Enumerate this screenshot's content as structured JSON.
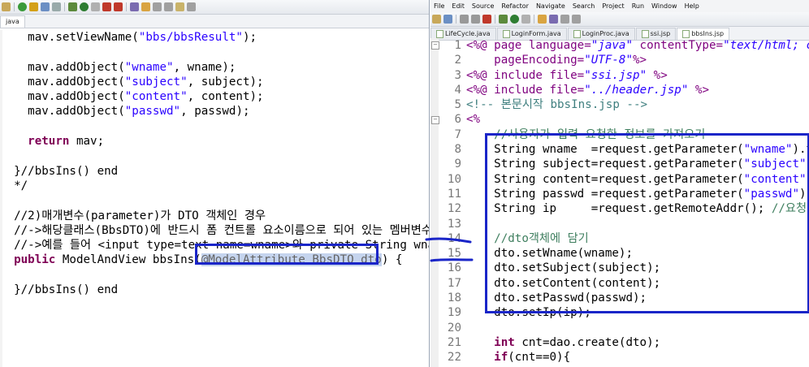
{
  "left_editor": {
    "tab_label": "java",
    "lines": [
      {
        "indent": "    ",
        "parts": [
          {
            "t": "mav.setViewName(",
            "c": ""
          },
          {
            "t": "\"bbs/bbsResult\"",
            "c": "str"
          },
          {
            "t": ");",
            "c": ""
          }
        ]
      },
      {
        "indent": "",
        "parts": []
      },
      {
        "indent": "    ",
        "parts": [
          {
            "t": "mav.addObject(",
            "c": ""
          },
          {
            "t": "\"wname\"",
            "c": "str"
          },
          {
            "t": ", wname);",
            "c": ""
          }
        ]
      },
      {
        "indent": "    ",
        "parts": [
          {
            "t": "mav.addObject(",
            "c": ""
          },
          {
            "t": "\"subject\"",
            "c": "str"
          },
          {
            "t": ", subject);",
            "c": ""
          }
        ]
      },
      {
        "indent": "    ",
        "parts": [
          {
            "t": "mav.addObject(",
            "c": ""
          },
          {
            "t": "\"content\"",
            "c": "str"
          },
          {
            "t": ", content);",
            "c": ""
          }
        ]
      },
      {
        "indent": "    ",
        "parts": [
          {
            "t": "mav.addObject(",
            "c": ""
          },
          {
            "t": "\"passwd\"",
            "c": "str"
          },
          {
            "t": ", passwd);",
            "c": ""
          }
        ]
      },
      {
        "indent": "",
        "parts": []
      },
      {
        "indent": "    ",
        "parts": [
          {
            "t": "return",
            "c": "kw"
          },
          {
            "t": " mav;",
            "c": ""
          }
        ]
      },
      {
        "indent": "",
        "parts": []
      },
      {
        "indent": "  ",
        "parts": [
          {
            "t": "}//bbsIns() end",
            "c": ""
          }
        ]
      },
      {
        "indent": "  ",
        "parts": [
          {
            "t": "*/",
            "c": ""
          }
        ]
      },
      {
        "indent": "",
        "parts": []
      },
      {
        "indent": "  ",
        "parts": [
          {
            "t": "//2)매개변수(parameter)가 DTO 객체인 경우",
            "c": ""
          }
        ]
      },
      {
        "indent": "  ",
        "parts": [
          {
            "t": "//->해당클래스(BbsDTO)에 반드시 폼 컨트롤 요소이름으로 되어 있는 멤버변수와",
            "c": ""
          }
        ]
      },
      {
        "indent": "  ",
        "parts": [
          {
            "t": "//->예를 들어 <input type=text name=wname>와 private String wnam",
            "c": ""
          }
        ]
      },
      {
        "indent": "  ",
        "parts": [
          {
            "t": "public",
            "c": "kw"
          },
          {
            "t": " ModelAndView bbsIns(",
            "c": ""
          },
          {
            "t": "@ModelAttribute BbsDTO dto",
            "c": "ann sel"
          },
          {
            "t": ") {",
            "c": ""
          }
        ]
      },
      {
        "indent": "",
        "parts": []
      },
      {
        "indent": "  ",
        "parts": [
          {
            "t": "}//bbsIns() end",
            "c": ""
          }
        ]
      }
    ]
  },
  "right_editor": {
    "menu": [
      "File",
      "Edit",
      "Source",
      "Refactor",
      "Navigate",
      "Search",
      "Project",
      "Run",
      "Window",
      "Help"
    ],
    "tabs": [
      "LifeCycle.java",
      "LoginForm.java",
      "LoginProc.java",
      "ssi.jsp",
      "bbsIns.jsp"
    ],
    "active_tab": 4,
    "line_numbers": [
      "1",
      "2",
      "3",
      "4",
      "5",
      "6",
      "7",
      "8",
      "9",
      "10",
      "11",
      "12",
      "13",
      "14",
      "15",
      "16",
      "17",
      "18",
      "19",
      "20",
      "21",
      "22"
    ],
    "lines": [
      {
        "indent": "",
        "parts": [
          {
            "t": "<%@ ",
            "c": "jsp"
          },
          {
            "t": "page ",
            "c": "jsp"
          },
          {
            "t": "language=",
            "c": "attr"
          },
          {
            "t": "\"java\"",
            "c": "aval"
          },
          {
            "t": " contentType=",
            "c": "attr"
          },
          {
            "t": "\"text/html; cha",
            "c": "aval"
          }
        ]
      },
      {
        "indent": "    ",
        "parts": [
          {
            "t": "pageEncoding=",
            "c": "attr"
          },
          {
            "t": "\"UTF-8\"",
            "c": "aval"
          },
          {
            "t": "%>",
            "c": "jsp"
          }
        ]
      },
      {
        "indent": "",
        "parts": [
          {
            "t": "<%@ ",
            "c": "jsp"
          },
          {
            "t": "include ",
            "c": "jsp"
          },
          {
            "t": "file=",
            "c": "attr"
          },
          {
            "t": "\"ssi.jsp\"",
            "c": "aval"
          },
          {
            "t": " %>",
            "c": "jsp"
          }
        ]
      },
      {
        "indent": "",
        "parts": [
          {
            "t": "<%@ ",
            "c": "jsp"
          },
          {
            "t": "include ",
            "c": "jsp"
          },
          {
            "t": "file=",
            "c": "attr"
          },
          {
            "t": "\"../header.jsp\"",
            "c": "aval"
          },
          {
            "t": " %>",
            "c": "jsp"
          }
        ]
      },
      {
        "indent": "",
        "parts": [
          {
            "t": "<!-- 본문시작 bbsIns.jsp -->",
            "c": "html"
          }
        ]
      },
      {
        "indent": "",
        "parts": [
          {
            "t": "<%",
            "c": "jsp"
          }
        ]
      },
      {
        "indent": "    ",
        "parts": [
          {
            "t": "//사용자가 입력 요청한 정보를 가져오기",
            "c": "cm"
          }
        ]
      },
      {
        "indent": "    ",
        "parts": [
          {
            "t": "String wname  =request.getParameter(",
            "c": ""
          },
          {
            "t": "\"wname\"",
            "c": "str"
          },
          {
            "t": ").tr",
            "c": ""
          }
        ]
      },
      {
        "indent": "    ",
        "parts": [
          {
            "t": "String subject=request.getParameter(",
            "c": ""
          },
          {
            "t": "\"subject\"",
            "c": "str"
          },
          {
            "t": ").",
            "c": ""
          }
        ]
      },
      {
        "indent": "    ",
        "parts": [
          {
            "t": "String content=request.getParameter(",
            "c": ""
          },
          {
            "t": "\"content\"",
            "c": "str"
          },
          {
            "t": ").",
            "c": ""
          }
        ]
      },
      {
        "indent": "    ",
        "parts": [
          {
            "t": "String passwd =request.getParameter(",
            "c": ""
          },
          {
            "t": "\"passwd\"",
            "c": "str"
          },
          {
            "t": ").t",
            "c": ""
          }
        ]
      },
      {
        "indent": "    ",
        "parts": [
          {
            "t": "String ip     =request.getRemoteAddr(); ",
            "c": ""
          },
          {
            "t": "//요청PC",
            "c": "cm"
          }
        ]
      },
      {
        "indent": "",
        "parts": []
      },
      {
        "indent": "    ",
        "parts": [
          {
            "t": "//dto객체에 담기",
            "c": "cm"
          }
        ]
      },
      {
        "indent": "    ",
        "parts": [
          {
            "t": "dto.setWname(wname);",
            "c": ""
          }
        ]
      },
      {
        "indent": "    ",
        "parts": [
          {
            "t": "dto.setSubject(subject);",
            "c": ""
          }
        ]
      },
      {
        "indent": "    ",
        "parts": [
          {
            "t": "dto.setContent(content);",
            "c": ""
          }
        ]
      },
      {
        "indent": "    ",
        "parts": [
          {
            "t": "dto.setPasswd(passwd);",
            "c": ""
          }
        ]
      },
      {
        "indent": "    ",
        "parts": [
          {
            "t": "dto.setIp(ip);",
            "c": ""
          }
        ]
      },
      {
        "indent": "",
        "parts": []
      },
      {
        "indent": "    ",
        "parts": [
          {
            "t": "int",
            "c": "kw"
          },
          {
            "t": " cnt=dao.create(dto);",
            "c": ""
          }
        ]
      },
      {
        "indent": "    ",
        "parts": [
          {
            "t": "if",
            "c": "kw"
          },
          {
            "t": "(cnt==0){",
            "c": ""
          }
        ]
      }
    ]
  }
}
